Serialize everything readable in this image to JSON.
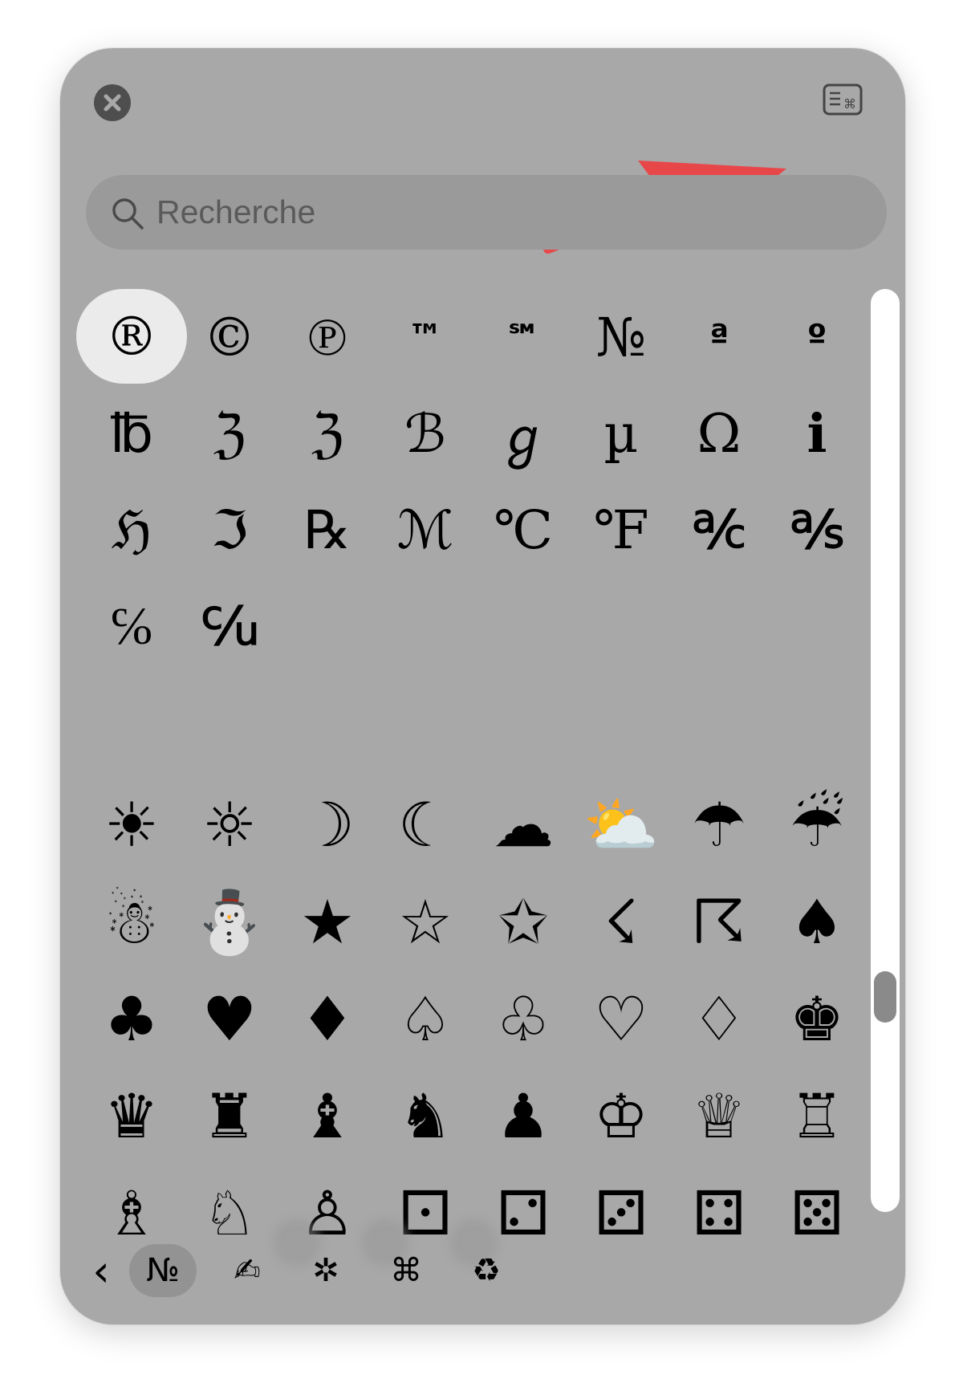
{
  "search": {
    "placeholder": "Recherche"
  },
  "symbols_letterlike": [
    "®",
    "©",
    "℗",
    "™",
    "℠",
    "№",
    "ª",
    "º",
    "℔",
    "ℨ",
    "ℨ",
    "ℬ",
    "ℊ",
    "µ",
    "Ω",
    "ℹ",
    "ℌ",
    "ℑ",
    "℞",
    "ℳ",
    "℃",
    "℉",
    "℀",
    "℁",
    "℅",
    "℆"
  ],
  "symbols_pictographs": [
    "☀",
    "☼",
    "☽",
    "☾",
    "☁",
    "⛅",
    "☂",
    "☔",
    "☃",
    "⛄",
    "★",
    "☆",
    "✩",
    "☇",
    "☈",
    "♠",
    "♣",
    "♥",
    "♦",
    "♤",
    "♧",
    "♡",
    "♢",
    "♚",
    "♛",
    "♜",
    "♝",
    "♞",
    "♟",
    "♔",
    "♕",
    "♖",
    "♗",
    "♘",
    "♙",
    "⚀",
    "⚁",
    "⚂",
    "⚃",
    "⚄"
  ],
  "tabs": [
    {
      "glyph": "‹",
      "name": "back"
    },
    {
      "glyph": "№",
      "name": "letterlike-symbols",
      "active": true
    },
    {
      "glyph": "✍",
      "name": "pictographs"
    },
    {
      "glyph": "✲",
      "name": "bullets-stars"
    },
    {
      "glyph": "⌘",
      "name": "technical-symbols"
    },
    {
      "glyph": "♻",
      "name": "recycle"
    }
  ],
  "colors": {
    "panel": "#a8a8a8",
    "arrow": "#e8474a",
    "selected": "#ebebeb"
  }
}
